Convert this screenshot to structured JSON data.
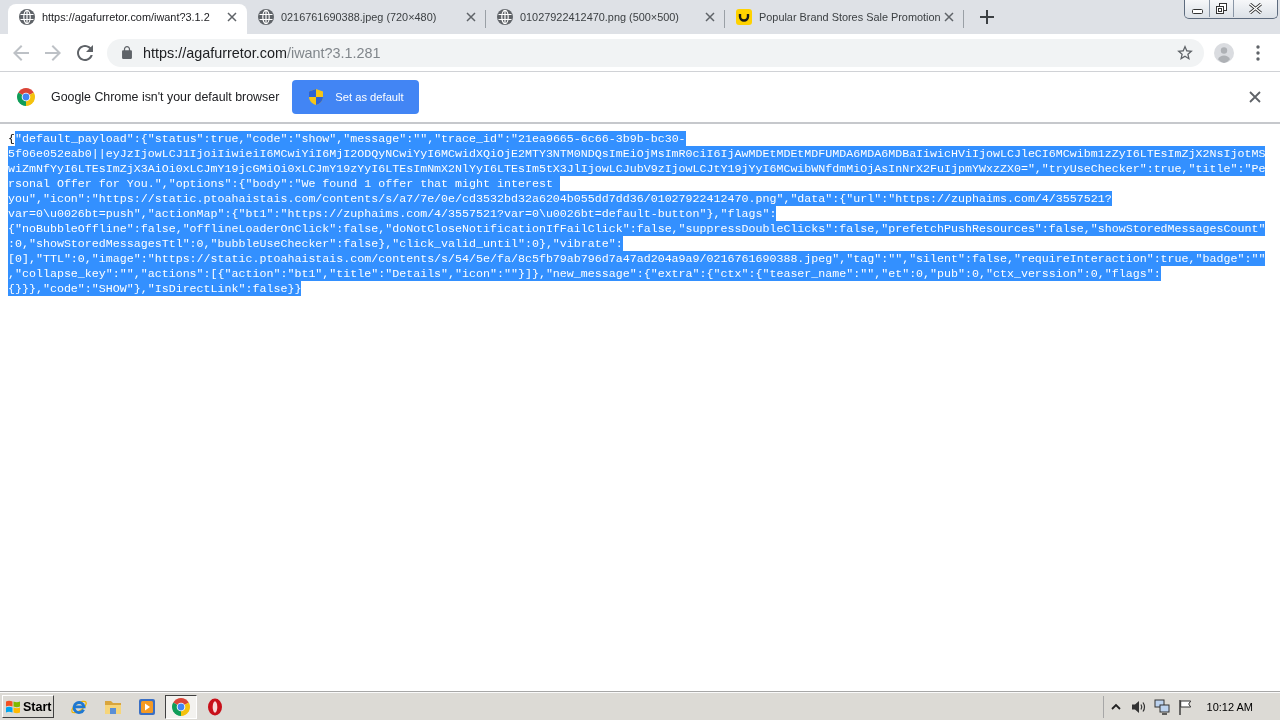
{
  "tabs": [
    {
      "kind": "page",
      "title": "https://agafurretor.com/iwant?3.1.2",
      "selected": true
    },
    {
      "kind": "page",
      "title": "0216761690388.jpeg (720×480)",
      "selected": false
    },
    {
      "kind": "page",
      "title": "01027922412470.png (500×500)",
      "selected": false
    },
    {
      "kind": "logo",
      "title": "Popular Brand Stores Sale Promotion",
      "selected": false
    }
  ],
  "toolbar": {
    "nav": [
      {
        "kind": "back",
        "disabled": true
      },
      {
        "kind": "forward",
        "disabled": true
      },
      {
        "kind": "reload",
        "disabled": false
      }
    ],
    "address": {
      "host": "https://agafurretor.com",
      "path": "/iwant?3.1.281"
    }
  },
  "infobar": {
    "message": "Google Chrome isn't your default browser",
    "button": "Set as default"
  },
  "document": {
    "lines": [
      {
        "segments": [
          {
            "text": "{",
            "selected": false
          },
          {
            "text": "\"default_payload\":{\"status\":true,\"code\":\"show\",\"message\":\"\",\"trace_id\":\"21ea9665-6c66-3b9b-bc30-",
            "selected": true
          }
        ]
      },
      {
        "segments": [
          {
            "text": "5f06e052eab0||eyJzIjowLCJ1IjoiIiwieiI6MCwiYiI6MjI2ODQyNCwiYyI6MCwidXQiOjE2MTY3NTM0NDQsImEiOjMsImR0ciI6IjAwMDEtMDEtMDFUMDA6MDA6MDBaIiwicHViIjowLCJleCI6MCwibm1zZyI6LTEsImZjX2NsIjotMS",
            "selected": true
          }
        ]
      },
      {
        "segments": [
          {
            "text": "wiZmNfYyI6LTEsImZjX3AiOi0xLCJmY19jcGMiOi0xLCJmY19zYyI6LTEsImNmX2NlYyI6LTEsIm5tX3JlIjowLCJubV9zIjowLCJtY19jYyI6MCwibWNfdmMiOjAsInNrX2FuIjpmYWxzZX0=\",\"tryUseChecker\":true,\"title\":\"Pe",
            "selected": true
          }
        ]
      },
      {
        "segments": [
          {
            "text": "rsonal Offer for You.\",\"options\":{\"body\":\"We found 1 offer that might interest ",
            "selected": true
          }
        ]
      },
      {
        "segments": [
          {
            "text": "you\",\"icon\":\"https://static.ptoahaistais.com/contents/s/a7/7e/0e/cd3532bd32a6204b055dd7dd36/01027922412470.png\",\"data\":{\"url\":\"https://zuphaims.com/4/3557521?",
            "selected": true
          }
        ]
      },
      {
        "segments": [
          {
            "text": "var=0\\u0026bt=push\",\"actionMap\":{\"bt1\":\"https://zuphaims.com/4/3557521?var=0\\u0026bt=default-button\"},\"flags\":",
            "selected": true
          }
        ]
      },
      {
        "segments": [
          {
            "text": "{\"noBubbleOffline\":false,\"offlineLoaderOnClick\":false,\"doNotCloseNotificationIfFailClick\":false,\"suppressDoubleClicks\":false,\"prefetchPushResources\":false,\"showStoredMessagesCount\"",
            "selected": true
          }
        ]
      },
      {
        "segments": [
          {
            "text": ":0,\"showStoredMessagesTtl\":0,\"bubbleUseChecker\":false},\"click_valid_until\":0},\"vibrate\":",
            "selected": true
          }
        ]
      },
      {
        "segments": [
          {
            "text": "[0],\"TTL\":0,\"image\":\"https://static.ptoahaistais.com/contents/s/54/5e/fa/8c5fb79ab796d7a47ad204a9a9/0216761690388.jpeg\",\"tag\":\"\",\"silent\":false,\"requireInteraction\":true,\"badge\":\"\"",
            "selected": true
          }
        ]
      },
      {
        "segments": [
          {
            "text": ",\"collapse_key\":\"\",\"actions\":[{\"action\":\"bt1\",\"title\":\"Details\",\"icon\":\"\"}]},\"new_message\":{\"extra\":{\"ctx\":{\"teaser_name\":\"\",\"et\":0,\"pub\":0,\"ctx_verssion\":0,\"flags\":",
            "selected": true
          }
        ]
      },
      {
        "segments": [
          {
            "text": "{}}},\"code\":\"SHOW\"},\"IsDirectLink\":false}}",
            "selected": true
          }
        ]
      }
    ]
  },
  "taskbar": {
    "start": "Start",
    "apps": [
      {
        "kind": "ie",
        "selected": false
      },
      {
        "kind": "folder",
        "selected": false
      },
      {
        "kind": "media",
        "selected": false
      },
      {
        "kind": "chrome",
        "selected": true
      },
      {
        "kind": "opera",
        "selected": false
      }
    ],
    "clock": "10:12 AM"
  }
}
